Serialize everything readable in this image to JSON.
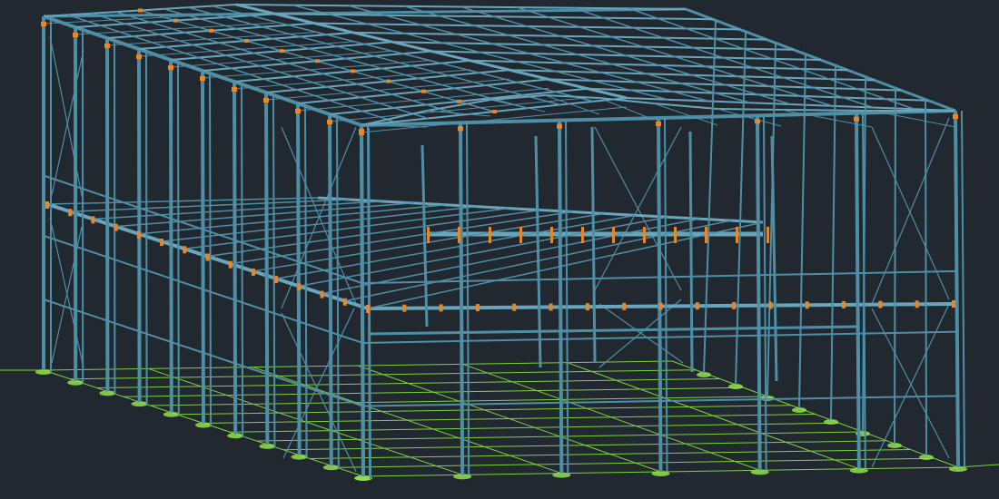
{
  "viewport": {
    "view": "3D model view",
    "background_color": "#212830"
  },
  "colors": {
    "steel_member": "#4f8fa6",
    "steel_member_light": "#6aa6bb",
    "connection_plate": "#e8862a",
    "foundation_grid": "#7fd23a",
    "foundation_pad": "#8fe04a"
  },
  "model": {
    "type": "steel-frame-building",
    "elements": [
      "columns",
      "roof-trusses",
      "roof-purlins",
      "mezzanine-floor",
      "cross-bracing",
      "connection-plates",
      "foundation-pads",
      "grid-lines"
    ]
  }
}
